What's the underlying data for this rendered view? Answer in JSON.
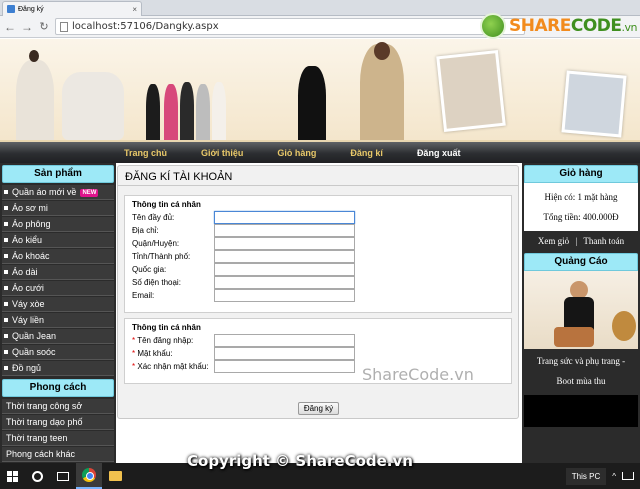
{
  "browser": {
    "tab_title": "Đăng ký",
    "tab_close": "×",
    "url": "localhost:57106/Dangky.aspx",
    "back": "←",
    "forward": "→",
    "reload": "C"
  },
  "watermark": {
    "logo_share": "SHARE",
    "logo_code": "CODE",
    "logo_vn": ".vn",
    "mid_text": "ShareCode.vn",
    "copyright": "Copyright © ShareCode.vn"
  },
  "nav": {
    "items": [
      "Trang chủ",
      "Giới thiệu",
      "Giỏ hàng",
      "Đăng kí",
      "Đăng xuất"
    ]
  },
  "sidebar": {
    "products_title": "Sản phẩm",
    "products": [
      "Quần áo mới về",
      "Áo sơ mi",
      "Áo phông",
      "Áo kiểu",
      "Áo khoác",
      "Áo dài",
      "Áo cưới",
      "Váy xòe",
      "Váy liền",
      "Quần Jean",
      "Quần soóc",
      "Đồ ngủ"
    ],
    "new_badge": "NEW",
    "style_title": "Phong cách",
    "styles": [
      "Thời trang công sở",
      "Thời trang dạo phố",
      "Thời trang teen",
      "Phong cách khác"
    ]
  },
  "form": {
    "title": "ĐĂNG KÍ TÀI KHOẢN",
    "section1_title": "Thông tin cá nhân",
    "section1_fields": [
      "Tên đầy đủ:",
      "Địa chỉ:",
      "Quận/Huyện:",
      "Tỉnh/Thành phố:",
      "Quốc gia:",
      "Số điện thoại:",
      "Email:"
    ],
    "section2_title": "Thông tin cá nhân",
    "required_mark": "*",
    "section2_fields": [
      "Tên đăng nhập:",
      "Mật khẩu:",
      "Xác nhận mật khẩu:"
    ],
    "submit": "Đăng ký"
  },
  "cart": {
    "title": "Giỏ hàng",
    "count_text": "Hiện có: 1 mặt hàng",
    "total_text": "Tổng tiền: 400.000Đ",
    "view_link": "Xem giỏ",
    "separator": "|",
    "checkout_link": "Thanh toán"
  },
  "ad": {
    "title": "Quảng Cáo",
    "caption_line1": "Trang sức và phụ trang -",
    "caption_line2": "Boot mùa thu"
  },
  "taskbar": {
    "this_pc": "This PC",
    "chevron": "^"
  },
  "colors": {
    "nav_text": "#e8c869",
    "side_head": "#9de9f7",
    "dark_panel": "#2b2b2b",
    "required": "#dd0000"
  }
}
